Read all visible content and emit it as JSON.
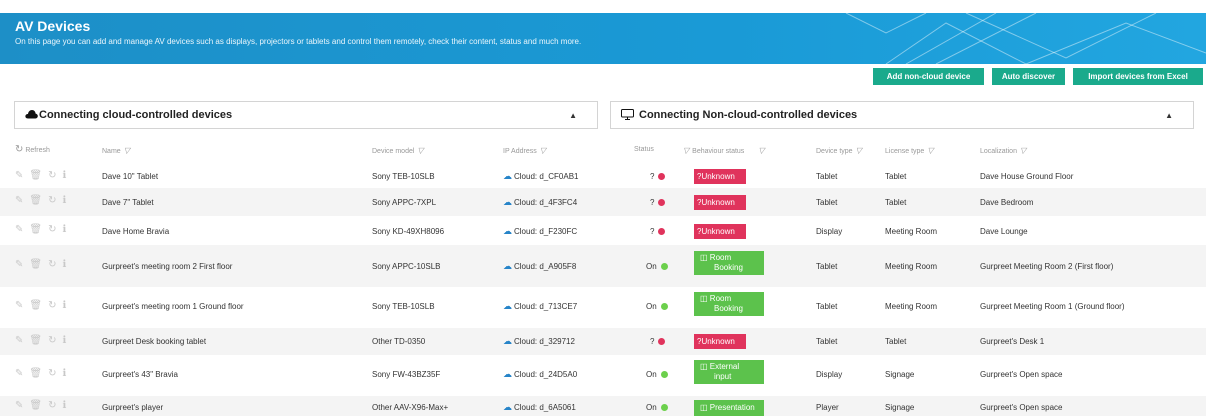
{
  "header": {
    "title": "AV Devices",
    "description": "On this page you can add and manage AV devices such as displays, projectors or tablets and control them remotely, check their content, status and much more."
  },
  "actions": {
    "add_non_cloud": "Add non-cloud device",
    "auto_discover": "Auto discover",
    "import_excel": "Import devices from Excel"
  },
  "panels": {
    "cloud": "Connecting cloud-controlled devices",
    "noncloud": "Connecting Non-cloud-controlled devices"
  },
  "columns": {
    "refresh": "Refresh",
    "name": "Name",
    "device_model": "Device model",
    "ip_address": "IP Address",
    "status": "Status",
    "behaviour_status": "Behaviour status",
    "device_type": "Device type",
    "license_type": "License type",
    "localization": "Localization"
  },
  "rows": [
    {
      "name": "Dave 10\" Tablet",
      "model": "Sony TEB-10SLB",
      "ip": "Cloud: d_CF0AB1",
      "status": "?",
      "behaviour": "?Unknown",
      "type": "Tablet",
      "license": "Tablet",
      "location": "Dave House Ground Floor"
    },
    {
      "name": "Dave 7\" Tablet",
      "model": "Sony APPC-7XPL",
      "ip": "Cloud: d_4F3FC4",
      "status": "?",
      "behaviour": "?Unknown",
      "type": "Tablet",
      "license": "Tablet",
      "location": "Dave Bedroom"
    },
    {
      "name": "Dave Home Bravia",
      "model": "Sony KD-49XH8096",
      "ip": "Cloud: d_F230FC",
      "status": "?",
      "behaviour": "?Unknown",
      "type": "Display",
      "license": "Meeting Room",
      "location": "Dave Lounge"
    },
    {
      "name": "Gurpreet's meeting room 2 First floor",
      "model": "Sony APPC-10SLB",
      "ip": "Cloud: d_A905F8",
      "status": "On",
      "behaviour_line1": "Room",
      "behaviour_line2": "Booking",
      "type": "Tablet",
      "license": "Meeting Room",
      "location": "Gurpreet Meeting Room 2 (First floor)"
    },
    {
      "name": "Gurpreet's meeting room 1 Ground floor",
      "model": "Sony TEB-10SLB",
      "ip": "Cloud: d_713CE7",
      "status": "On",
      "behaviour_line1": "Room",
      "behaviour_line2": "Booking",
      "type": "Tablet",
      "license": "Meeting Room",
      "location": "Gurpreet Meeting Room 1 (Ground floor)"
    },
    {
      "name": "Gurpreet Desk booking tablet",
      "model": "Other TD-0350",
      "ip": "Cloud: d_329712",
      "status": "?",
      "behaviour": "?Unknown",
      "type": "Tablet",
      "license": "Tablet",
      "location": "Gurpreet's Desk 1"
    },
    {
      "name": "Gurpreet's 43\" Bravia",
      "model": "Sony FW-43BZ35F",
      "ip": "Cloud: d_24D5A0",
      "status": "On",
      "behaviour_line1": "External",
      "behaviour_line2": "input",
      "type": "Display",
      "license": "Signage",
      "location": "Gurpreet's Open space"
    },
    {
      "name": "Gurpreet's player",
      "model": "Other AAV-X96-Max+",
      "ip": "Cloud: d_6A5061",
      "status": "On",
      "behaviour_line1": "Presentation",
      "type": "Player",
      "license": "Signage",
      "location": "Gurpreet's Open space"
    }
  ],
  "colors": {
    "accent": "#1aaa8c",
    "banner": "#1a9ad6",
    "unknown": "#e0335c",
    "ok": "#5cc24c"
  }
}
